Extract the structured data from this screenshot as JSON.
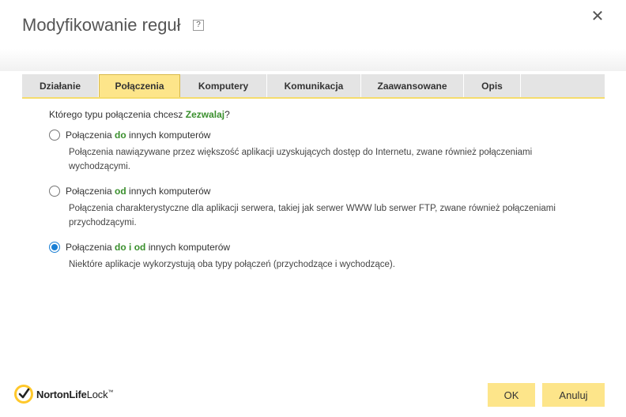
{
  "dialog": {
    "title": "Modyfikowanie reguł",
    "help": "?",
    "close": "✕"
  },
  "tabs": [
    {
      "label": "Działanie",
      "active": false
    },
    {
      "label": "Połączenia",
      "active": true
    },
    {
      "label": "Komputery",
      "active": false
    },
    {
      "label": "Komunikacja",
      "active": false
    },
    {
      "label": "Zaawansowane",
      "active": false
    },
    {
      "label": "Opis",
      "active": false
    }
  ],
  "question": {
    "prefix": "Którego typu połączenia chcesz ",
    "highlight": "Zezwalaj",
    "suffix": "?"
  },
  "options": [
    {
      "prefix": "Połączenia ",
      "highlight": "do",
      "suffix": " innych komputerów",
      "description_line1": "Połączenia nawiązywane przez większość aplikacji uzyskujących dostęp do Internetu, zwane również połączeniami",
      "description_line2": "wychodzącymi.",
      "checked": false
    },
    {
      "prefix": "Połączenia ",
      "highlight": "od",
      "suffix": " innych komputerów",
      "description_line1": "Połączenia charakterystyczne dla aplikacji serwera, takiej jak serwer WWW lub serwer FTP, zwane również połączeniami",
      "description_line2": "przychodzącymi.",
      "checked": false
    },
    {
      "prefix": "Połączenia ",
      "highlight": "do i od",
      "suffix": " innych komputerów",
      "description_line1": "Niektóre aplikacje wykorzystują oba typy połączeń (przychodzące i wychodzące).",
      "description_line2": "",
      "checked": true
    }
  ],
  "logo": {
    "brand_bold": "NortonLife",
    "brand_light": "Lock",
    "icon": "checkmark-icon",
    "trademark": "™"
  },
  "buttons": {
    "ok": "OK",
    "cancel": "Anuluj"
  },
  "colors": {
    "accent": "#fde58a",
    "highlight_text": "#3a8f2d",
    "radio_checked": "#1a7fd4"
  }
}
